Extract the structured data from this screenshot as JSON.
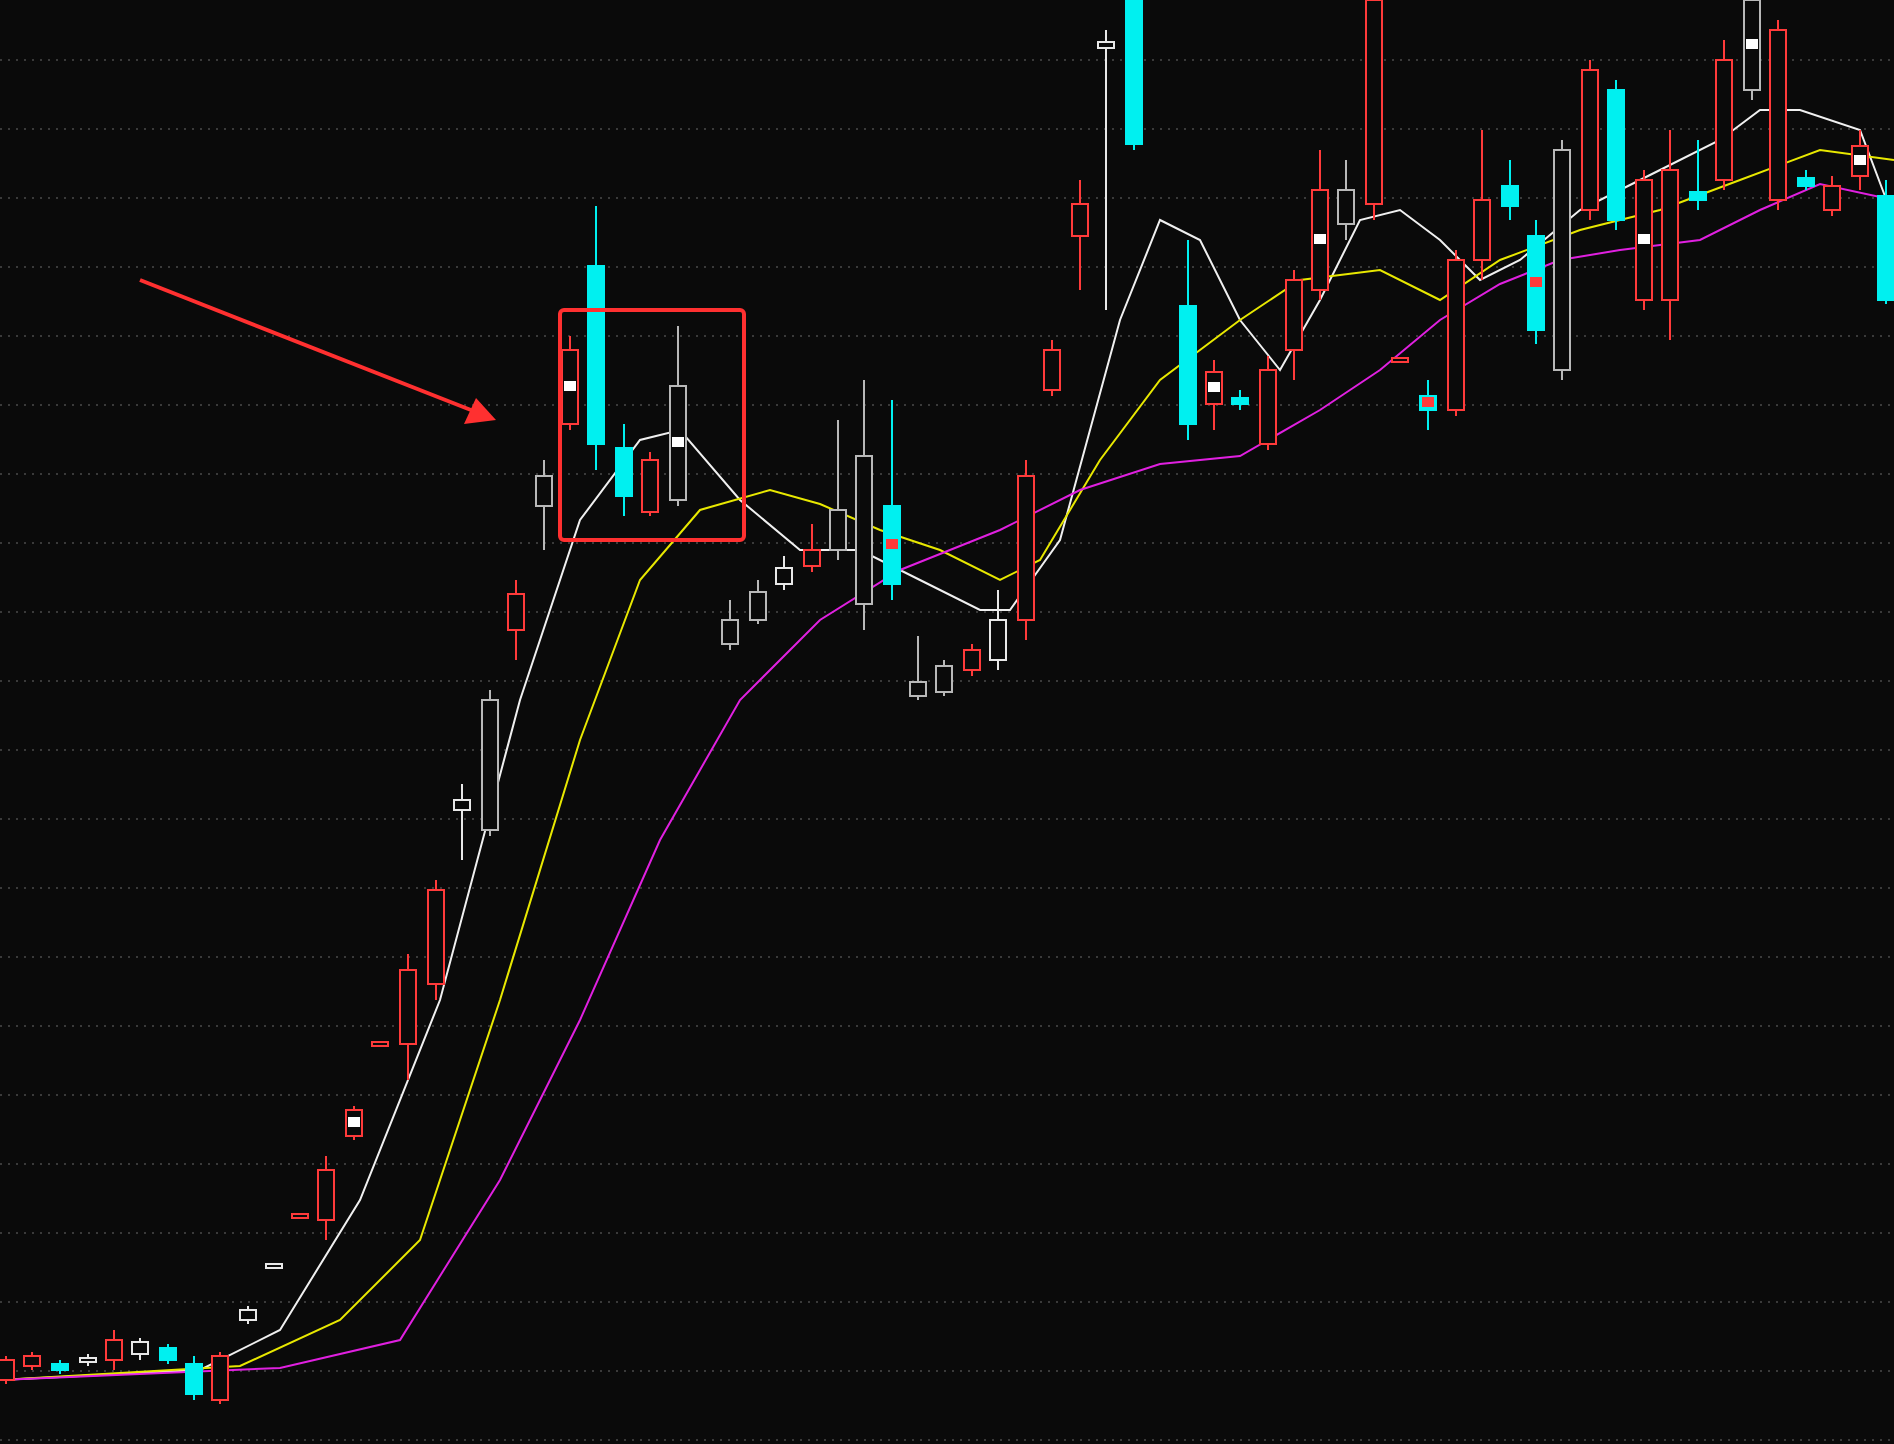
{
  "chart": {
    "kind": "candlestick",
    "annotations": {
      "box": true,
      "arrow": true
    }
  }
}
